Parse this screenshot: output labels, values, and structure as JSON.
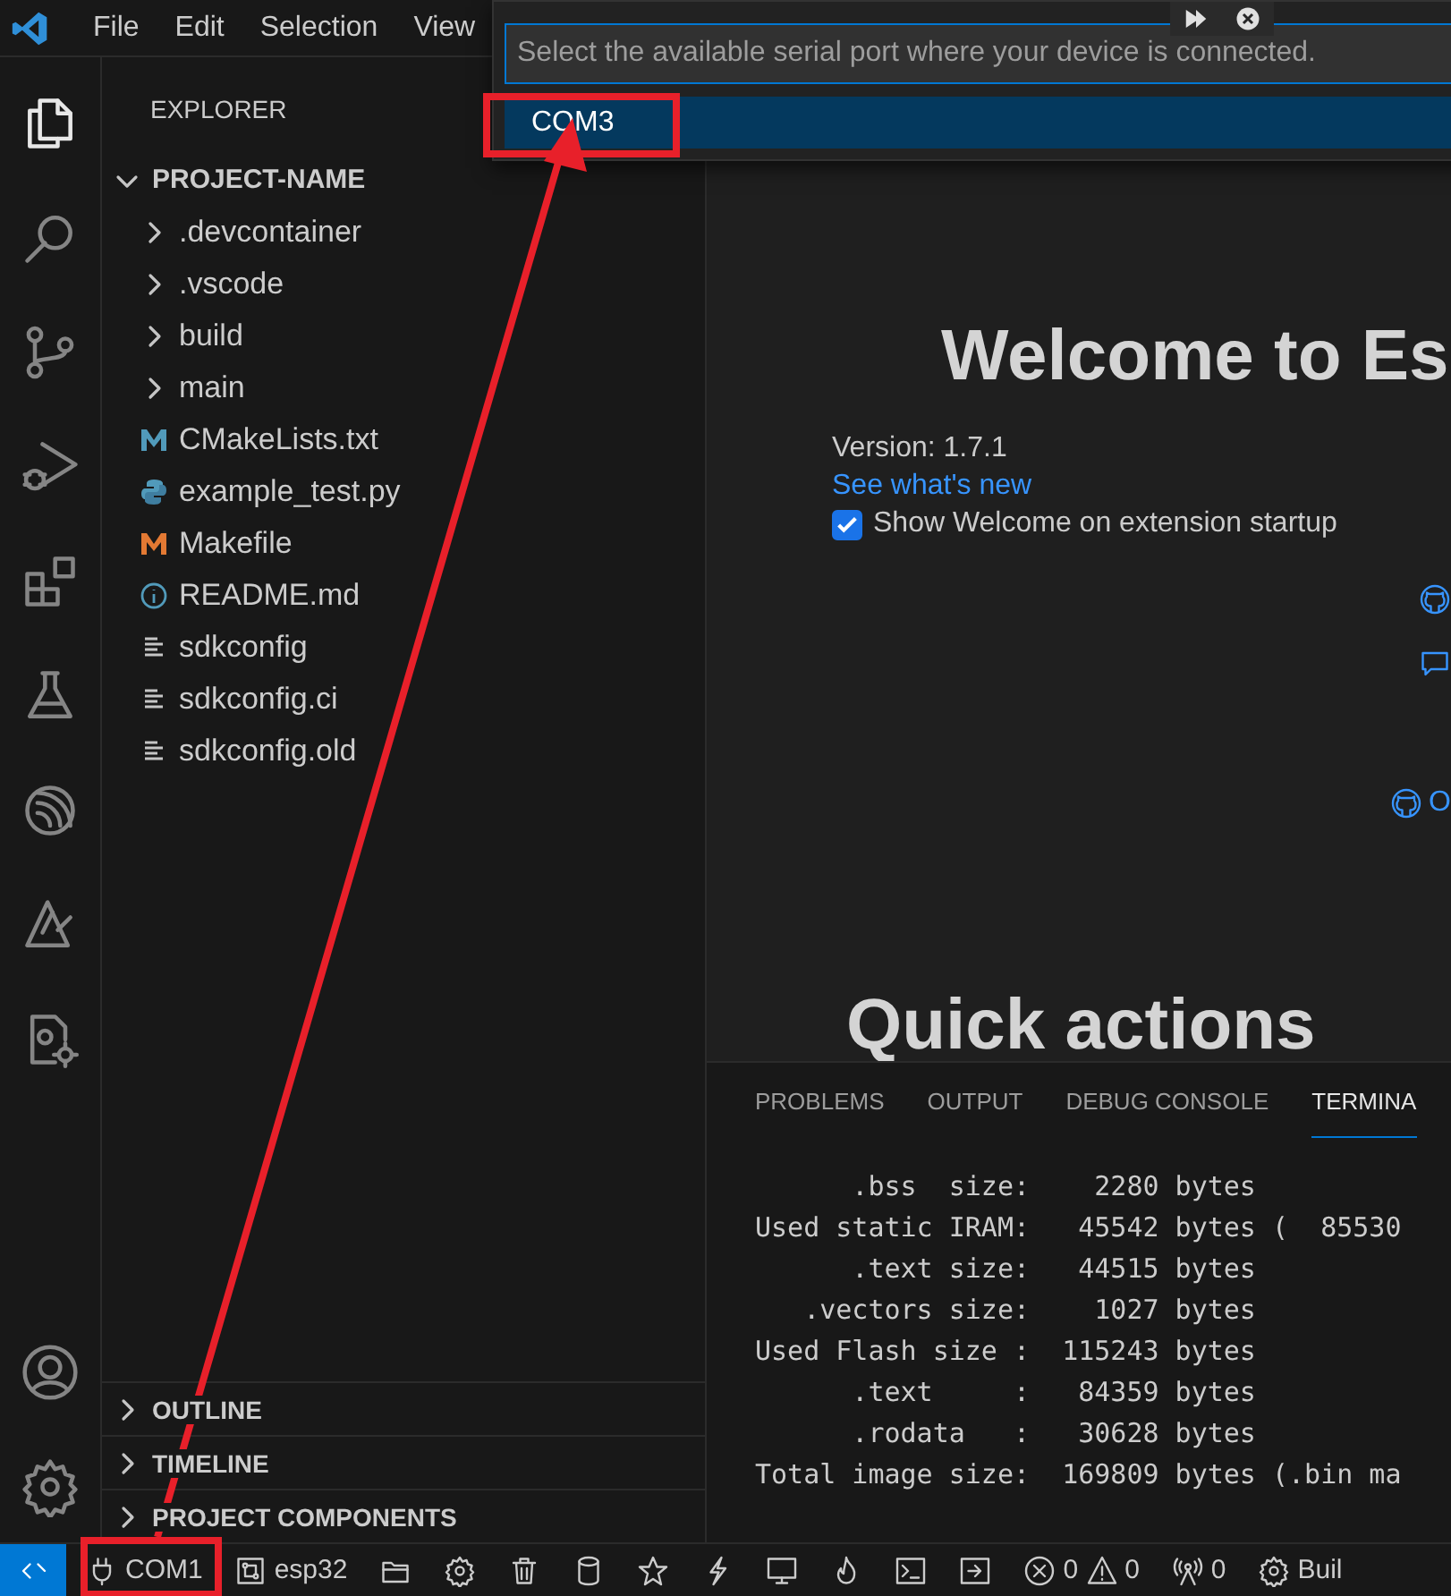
{
  "title_bar": {
    "menu": [
      "File",
      "Edit",
      "Selection",
      "View"
    ]
  },
  "activity_bar": {
    "items": [
      {
        "kind": "files",
        "selected": true
      },
      {
        "kind": "search",
        "selected": false
      },
      {
        "kind": "branch",
        "selected": false
      },
      {
        "kind": "debug",
        "selected": false
      },
      {
        "kind": "extensions",
        "selected": false
      },
      {
        "kind": "flask",
        "selected": false
      },
      {
        "kind": "espressif",
        "selected": false
      },
      {
        "kind": "tools",
        "selected": false
      },
      {
        "kind": "cppgear",
        "selected": false
      }
    ],
    "bottom": [
      {
        "kind": "account"
      },
      {
        "kind": "settings"
      }
    ]
  },
  "sidebar": {
    "title": "EXPLORER",
    "project": {
      "label": "PROJECT-NAME",
      "expanded": true,
      "children": [
        {
          "label": ".devcontainer",
          "kind": "folder",
          "expanded": false
        },
        {
          "label": ".vscode",
          "kind": "folder",
          "expanded": false
        },
        {
          "label": "build",
          "kind": "folder",
          "expanded": false
        },
        {
          "label": "main",
          "kind": "folder",
          "expanded": false
        },
        {
          "label": "CMakeLists.txt",
          "kind": "cmake"
        },
        {
          "label": "example_test.py",
          "kind": "python"
        },
        {
          "label": "Makefile",
          "kind": "make"
        },
        {
          "label": "README.md",
          "kind": "info"
        },
        {
          "label": "sdkconfig",
          "kind": "text"
        },
        {
          "label": "sdkconfig.ci",
          "kind": "text"
        },
        {
          "label": "sdkconfig.old",
          "kind": "text"
        }
      ]
    },
    "sections": [
      {
        "label": "OUTLINE",
        "expanded": false
      },
      {
        "label": "TIMELINE",
        "expanded": false
      },
      {
        "label": "PROJECT COMPONENTS",
        "expanded": false
      }
    ]
  },
  "quick_pick": {
    "placeholder": "Select the available serial port where your device is connected.",
    "items": [
      {
        "label": "COM3",
        "selected": true
      }
    ]
  },
  "welcome": {
    "title": "Welcome to Es",
    "version": "Version: 1.7.1",
    "link": "See what's new",
    "checkbox": {
      "label": "Show Welcome on extension startup",
      "checked": true
    },
    "side_links": [
      {
        "kind": "github"
      },
      {
        "kind": "comment"
      },
      {
        "kind": "github",
        "label": "O"
      }
    ],
    "section_title": "Quick actions"
  },
  "panel": {
    "tabs": [
      {
        "label": "PROBLEMS",
        "selected": false
      },
      {
        "label": "OUTPUT",
        "selected": false
      },
      {
        "label": "DEBUG CONSOLE",
        "selected": false
      },
      {
        "label": "TERMINA",
        "selected": true
      }
    ],
    "terminal_lines": [
      "      .bss  size:    2280 bytes",
      "Used static IRAM:   45542 bytes (  85530",
      "      .text size:   44515 bytes",
      "   .vectors size:    1027 bytes",
      "Used Flash size :  115243 bytes",
      "      .text     :   84359 bytes",
      "      .rodata   :   30628 bytes",
      "Total image size:  169809 bytes (.bin ma"
    ]
  },
  "status_bar": {
    "items": [
      {
        "kind": "remote"
      },
      {
        "kind": "port",
        "label": "COM1"
      },
      {
        "kind": "chip",
        "label": "esp32"
      },
      {
        "kind": "folder"
      },
      {
        "kind": "gear"
      },
      {
        "kind": "trash"
      },
      {
        "kind": "database"
      },
      {
        "kind": "star"
      },
      {
        "kind": "flash"
      },
      {
        "kind": "monitor"
      },
      {
        "kind": "flame"
      },
      {
        "kind": "terminal"
      },
      {
        "kind": "enter"
      },
      {
        "kind": "problems",
        "errors": "0",
        "warnings": "0"
      },
      {
        "kind": "antenna",
        "label": "0"
      },
      {
        "kind": "gear",
        "label": "Buil"
      }
    ]
  }
}
